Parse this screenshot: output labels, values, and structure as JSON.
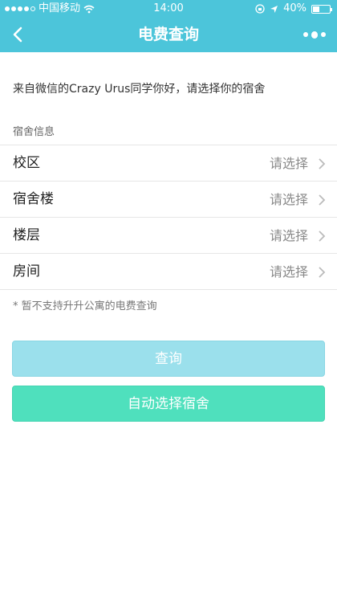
{
  "status_bar": {
    "carrier": "中国移动",
    "time": "14:00",
    "battery": "40%"
  },
  "nav": {
    "title": "电费查询"
  },
  "greeting": "来自微信的Crazy Urus同学你好，请选择你的宿舍",
  "section_label": "宿舍信息",
  "rows": [
    {
      "label": "校区",
      "value": "请选择"
    },
    {
      "label": "宿舍楼",
      "value": "请选择"
    },
    {
      "label": "楼层",
      "value": "请选择"
    },
    {
      "label": "房间",
      "value": "请选择"
    }
  ],
  "note": "* 暂不支持升升公寓的电费查询",
  "buttons": {
    "query": "查询",
    "auto_select": "自动选择宿舍"
  },
  "colors": {
    "header": "#4cc5da",
    "query_button": "#9be0ec",
    "auto_button": "#4fe0bd"
  }
}
